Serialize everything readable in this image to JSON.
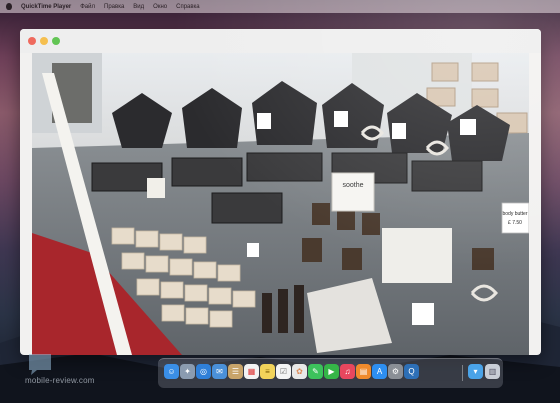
{
  "menubar": {
    "app_name": "QuickTime Player",
    "items": [
      "Файл",
      "Правка",
      "Вид",
      "Окно",
      "Справка"
    ]
  },
  "video_labels": {
    "soothe": "soothe",
    "body_butter": "body butter",
    "price": "£ 7.50"
  },
  "dock": {
    "items": [
      {
        "name": "finder",
        "color": "#3a8ee6"
      },
      {
        "name": "launchpad",
        "color": "#8a9bb0"
      },
      {
        "name": "safari",
        "color": "#2f7fd8"
      },
      {
        "name": "mail",
        "color": "#4a90d9"
      },
      {
        "name": "contacts",
        "color": "#c8a46a"
      },
      {
        "name": "calendar",
        "color": "#f3f3f3"
      },
      {
        "name": "notes",
        "color": "#f2d35a"
      },
      {
        "name": "reminders",
        "color": "#f4f4f4"
      },
      {
        "name": "photos",
        "color": "#e8e8e8"
      },
      {
        "name": "messages",
        "color": "#3cc25c"
      },
      {
        "name": "facetime",
        "color": "#35b548"
      },
      {
        "name": "itunes",
        "color": "#e8475e"
      },
      {
        "name": "ibooks",
        "color": "#f08a2c"
      },
      {
        "name": "app-store",
        "color": "#2d8ef0"
      },
      {
        "name": "system-preferences",
        "color": "#8a8f96"
      },
      {
        "name": "quicktime",
        "color": "#2d6fb6"
      },
      {
        "name": "downloads",
        "color": "#4aa3e8"
      },
      {
        "name": "trash",
        "color": "#c9ced6"
      }
    ]
  },
  "watermark": {
    "text": "mobile-review.com"
  }
}
